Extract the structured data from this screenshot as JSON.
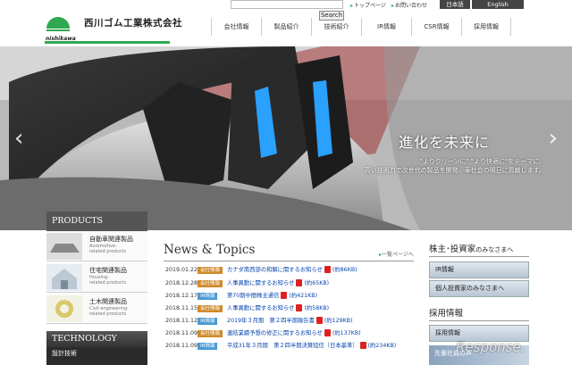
{
  "header": {
    "company_name": "西川ゴム工業株式会社",
    "logo_sub": "nishikawa",
    "search_button": "Search",
    "util_top": "トップページ",
    "util_contact": "お問い合わせ",
    "lang_ja": "日本語",
    "lang_en": "English",
    "accent_color": "#2fa84f"
  },
  "gnav": [
    "会社情報",
    "製品紹介",
    "技術紹介",
    "IR情報",
    "CSR情報",
    "採用情報"
  ],
  "hero": {
    "headline": "進化を未来に",
    "sub1": "\"よりクリーンに\" \"より快適に\"をテーマに、",
    "sub2": "高い技術力で次世代の製品を開発、車社会の明日に貢献します。",
    "prev": "‹",
    "next": "›"
  },
  "products": {
    "heading": "PRODUCTS",
    "items": [
      {
        "title": "自動車関連製品",
        "en1": "Automotive-",
        "en2": "related products"
      },
      {
        "title": "住宅関連製品",
        "en1": "Housing-",
        "en2": "related products"
      },
      {
        "title": "土木関連製品",
        "en1": "Civil engineering-",
        "en2": "related products"
      }
    ],
    "tech_heading": "TECHNOLOGY",
    "tech_sub": "設計技術"
  },
  "news": {
    "heading": "News & Topics",
    "more": "一覧ページへ",
    "items": [
      {
        "date": "2019.01.22",
        "cat": "会社情報",
        "title": "カナダ南西部の和解に関するお知らせ",
        "size": "(約86KB)"
      },
      {
        "date": "2018.12.28",
        "cat": "会社情報",
        "title": "人事異動に関するお知らせ",
        "size": "(約65KB)"
      },
      {
        "date": "2018.12.17",
        "cat": "IR情報",
        "title": "第70期中間株主通信",
        "size": "(約421KB)"
      },
      {
        "date": "2018.11.15",
        "cat": "会社情報",
        "title": "人事異動に関するお知らせ",
        "size": "(約58KB)"
      },
      {
        "date": "2018.11.12",
        "cat": "IR情報",
        "title": "2019年３月期　第２四半期報告書",
        "size": "(約129KB)"
      },
      {
        "date": "2018.11.09",
        "cat": "会社情報",
        "title": "連結業績予想の修正に関するお知らせ",
        "size": "(約137KB)"
      },
      {
        "date": "2018.11.09",
        "cat": "IR情報",
        "title": "平成31年３月期　第２四半期決算短信〔日本基準〕",
        "size": "(約234KB)"
      }
    ]
  },
  "ir": {
    "heading_main": "株主･投資家",
    "heading_small": "のみなさまへ",
    "buttons": [
      "IR情報",
      "個人投資家のみなさまへ"
    ]
  },
  "recruit": {
    "heading": "採用情報",
    "button": "採用情報",
    "banner": "先輩社員の声"
  },
  "watermark": "Response."
}
